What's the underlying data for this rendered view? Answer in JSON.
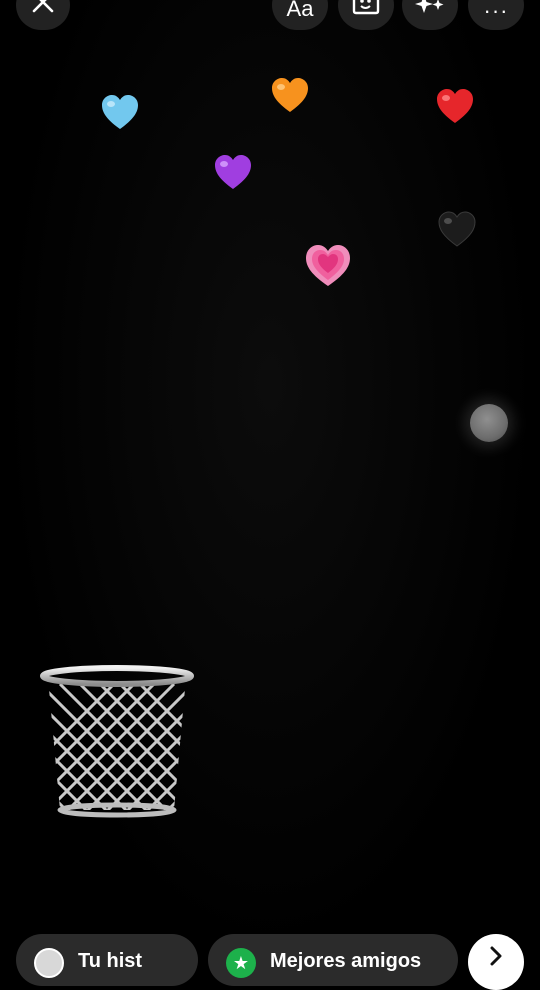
{
  "toolbar": {
    "close_icon": "close-icon",
    "text_label": "Aa",
    "sticker_icon": "sticker-icon",
    "effects_icon": "sparkles-icon",
    "more_label": "···"
  },
  "stickers": [
    {
      "name": "light-blue-heart-icon",
      "color": "#72c8ee"
    },
    {
      "name": "orange-heart-icon",
      "color": "#f7921e"
    },
    {
      "name": "red-heart-icon",
      "color": "#e6262b"
    },
    {
      "name": "purple-heart-icon",
      "color": "#a03ee0"
    },
    {
      "name": "black-heart-icon",
      "color": "#1c1c1c"
    },
    {
      "name": "pink-hearts-icon",
      "color": "#f0609e"
    }
  ],
  "trash": {
    "icon": "trash-icon"
  },
  "share_bar": {
    "story_label": "Tu hist",
    "friends_label": "Mejores amigos",
    "friends_color": "#1db14b",
    "next_icon": "chevron-right-icon"
  }
}
